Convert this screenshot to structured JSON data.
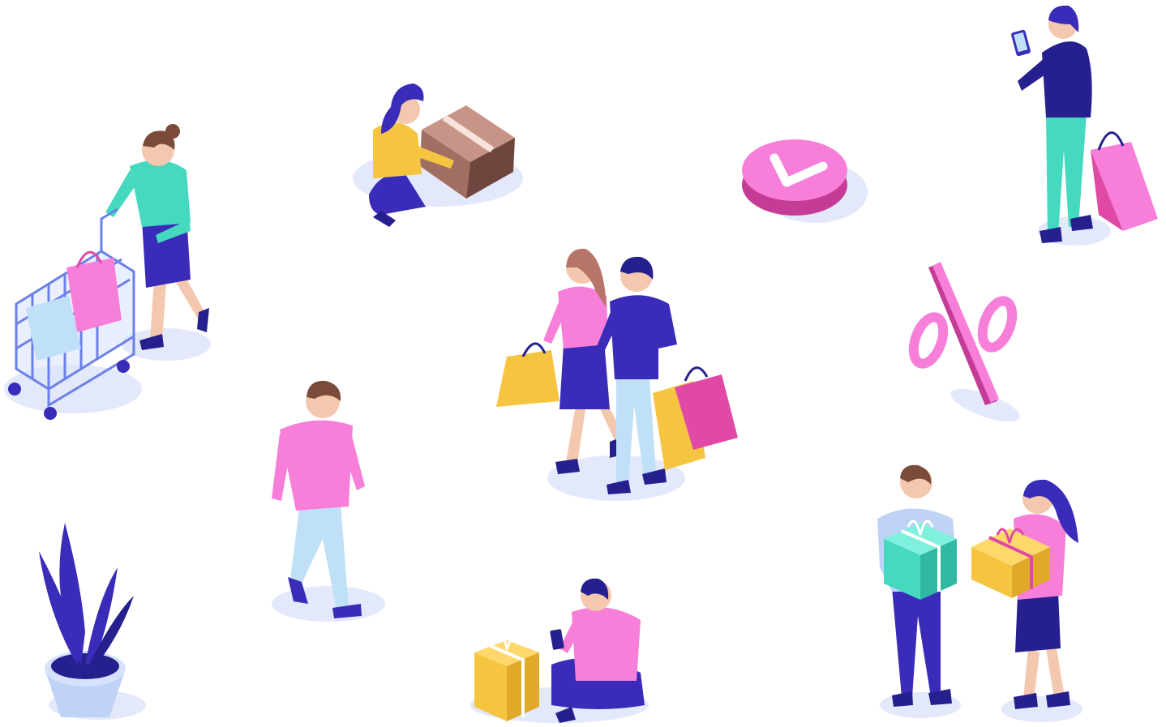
{
  "scene": {
    "description_free": true,
    "colors": {
      "background": "#ffffff",
      "shadow": "#e3e8fa",
      "indigo": "#3a2bb8",
      "indigo_dark": "#26208f",
      "pink": "#f77fd9",
      "magenta": "#e04aa6",
      "yellow": "#f5c542",
      "mint": "#45d9c0",
      "skin": "#f3c8ae",
      "hair_brown": "#7a4b3a",
      "box_brown": "#a06f62",
      "light_blue": "#bfe0f7"
    },
    "icons": [
      "shopping-cart-icon",
      "parcel-box-icon",
      "checkmark-badge-icon",
      "percent-sign-icon",
      "gift-box-icon",
      "shopping-bag-icon",
      "smartphone-icon",
      "potted-plant-icon"
    ]
  }
}
